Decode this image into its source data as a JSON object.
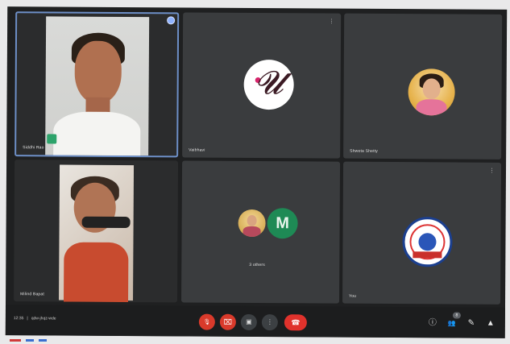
{
  "meeting": {
    "time": "12:35",
    "separator": "|",
    "code": "qdw-jhqz-wde"
  },
  "tiles": [
    {
      "name": "Siddhi Rao",
      "type": "video"
    },
    {
      "name": "Vaibhavi",
      "type": "avatar",
      "menu": "⋮"
    },
    {
      "name": "Shweta Shetty",
      "type": "avatar"
    },
    {
      "name": "Milind Bapat",
      "type": "video"
    },
    {
      "name": "3 others",
      "type": "group"
    },
    {
      "name": "You",
      "type": "avatar",
      "menu": "⋮"
    }
  ],
  "avatars": {
    "m_letter": "M"
  },
  "controls": {
    "mic_icon": "🎙",
    "cam_icon": "⌧",
    "present_icon": "▣",
    "more_icon": "⋮",
    "end_icon": "☎",
    "info_icon": "ⓘ",
    "people_icon": "👥",
    "people_count": "8",
    "chat_icon": "✎",
    "activities_icon": "▲"
  },
  "colors": {
    "active_border": "#6d8fc7",
    "end_call": "#e0322c",
    "muted_control": "#d93a2b",
    "avatar_m": "#1e8a55"
  }
}
